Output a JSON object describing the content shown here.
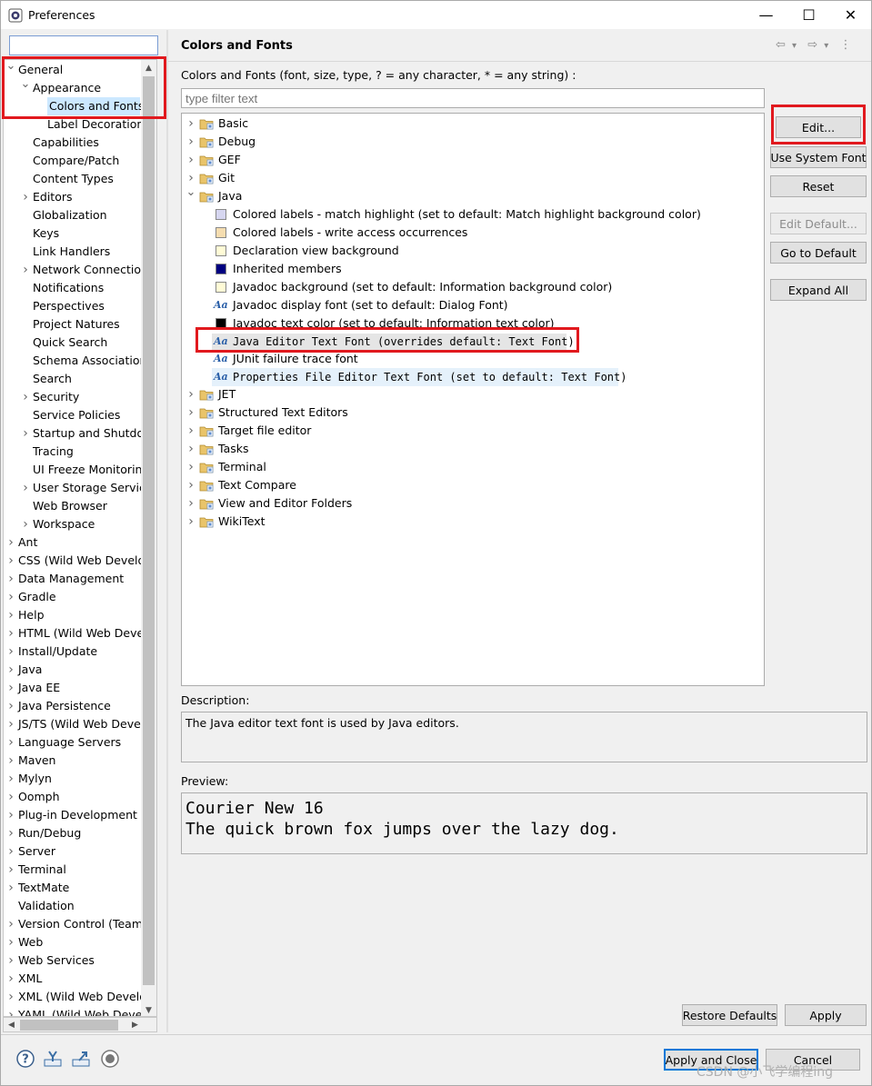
{
  "window": {
    "title": "Preferences",
    "minimize": "—",
    "maximize": "☐",
    "close": "✕"
  },
  "left_tree": {
    "filter_value": "",
    "items": [
      {
        "label": "General",
        "level": 0,
        "state": "expanded"
      },
      {
        "label": "Appearance",
        "level": 1,
        "state": "expanded"
      },
      {
        "label": "Colors and Fonts",
        "level": 2,
        "state": "leaf",
        "selected": true
      },
      {
        "label": "Label Decorations",
        "level": 2,
        "state": "leaf"
      },
      {
        "label": "Capabilities",
        "level": 1,
        "state": "leaf"
      },
      {
        "label": "Compare/Patch",
        "level": 1,
        "state": "leaf"
      },
      {
        "label": "Content Types",
        "level": 1,
        "state": "leaf"
      },
      {
        "label": "Editors",
        "level": 1,
        "state": "collapsed"
      },
      {
        "label": "Globalization",
        "level": 1,
        "state": "leaf"
      },
      {
        "label": "Keys",
        "level": 1,
        "state": "leaf"
      },
      {
        "label": "Link Handlers",
        "level": 1,
        "state": "leaf"
      },
      {
        "label": "Network Connections",
        "level": 1,
        "state": "collapsed"
      },
      {
        "label": "Notifications",
        "level": 1,
        "state": "leaf"
      },
      {
        "label": "Perspectives",
        "level": 1,
        "state": "leaf"
      },
      {
        "label": "Project Natures",
        "level": 1,
        "state": "leaf"
      },
      {
        "label": "Quick Search",
        "level": 1,
        "state": "leaf"
      },
      {
        "label": "Schema Associations",
        "level": 1,
        "state": "leaf"
      },
      {
        "label": "Search",
        "level": 1,
        "state": "leaf"
      },
      {
        "label": "Security",
        "level": 1,
        "state": "collapsed"
      },
      {
        "label": "Service Policies",
        "level": 1,
        "state": "leaf"
      },
      {
        "label": "Startup and Shutdown",
        "level": 1,
        "state": "collapsed"
      },
      {
        "label": "Tracing",
        "level": 1,
        "state": "leaf"
      },
      {
        "label": "UI Freeze Monitoring",
        "level": 1,
        "state": "leaf"
      },
      {
        "label": "User Storage Service",
        "level": 1,
        "state": "collapsed"
      },
      {
        "label": "Web Browser",
        "level": 1,
        "state": "leaf"
      },
      {
        "label": "Workspace",
        "level": 1,
        "state": "collapsed"
      },
      {
        "label": "Ant",
        "level": 0,
        "state": "collapsed"
      },
      {
        "label": "CSS (Wild Web Developer)",
        "level": 0,
        "state": "collapsed"
      },
      {
        "label": "Data Management",
        "level": 0,
        "state": "collapsed"
      },
      {
        "label": "Gradle",
        "level": 0,
        "state": "collapsed"
      },
      {
        "label": "Help",
        "level": 0,
        "state": "collapsed"
      },
      {
        "label": "HTML (Wild Web Developer)",
        "level": 0,
        "state": "collapsed"
      },
      {
        "label": "Install/Update",
        "level": 0,
        "state": "collapsed"
      },
      {
        "label": "Java",
        "level": 0,
        "state": "collapsed"
      },
      {
        "label": "Java EE",
        "level": 0,
        "state": "collapsed"
      },
      {
        "label": "Java Persistence",
        "level": 0,
        "state": "collapsed"
      },
      {
        "label": "JS/TS (Wild Web Developer)",
        "level": 0,
        "state": "collapsed"
      },
      {
        "label": "Language Servers",
        "level": 0,
        "state": "collapsed"
      },
      {
        "label": "Maven",
        "level": 0,
        "state": "collapsed"
      },
      {
        "label": "Mylyn",
        "level": 0,
        "state": "collapsed"
      },
      {
        "label": "Oomph",
        "level": 0,
        "state": "collapsed"
      },
      {
        "label": "Plug-in Development",
        "level": 0,
        "state": "collapsed"
      },
      {
        "label": "Run/Debug",
        "level": 0,
        "state": "collapsed"
      },
      {
        "label": "Server",
        "level": 0,
        "state": "collapsed"
      },
      {
        "label": "Terminal",
        "level": 0,
        "state": "collapsed"
      },
      {
        "label": "TextMate",
        "level": 0,
        "state": "collapsed"
      },
      {
        "label": "Validation",
        "level": 0,
        "state": "leaf"
      },
      {
        "label": "Version Control (Team)",
        "level": 0,
        "state": "collapsed"
      },
      {
        "label": "Web",
        "level": 0,
        "state": "collapsed"
      },
      {
        "label": "Web Services",
        "level": 0,
        "state": "collapsed"
      },
      {
        "label": "XML",
        "level": 0,
        "state": "collapsed"
      },
      {
        "label": "XML (Wild Web Developer)",
        "level": 0,
        "state": "collapsed"
      },
      {
        "label": "YAML (Wild Web Developer)",
        "level": 0,
        "state": "collapsed"
      }
    ]
  },
  "page": {
    "title": "Colors and Fonts",
    "description": "Colors and Fonts (font, size, type, ? = any character, * = any string) :",
    "filter_placeholder": "type filter text",
    "nav": {
      "back": "⇦",
      "back_menu": "▾",
      "forward": "⇨",
      "forward_menu": "▾",
      "more": "⋮"
    }
  },
  "font_tree": [
    {
      "label": "Basic",
      "kind": "category",
      "expanded": false
    },
    {
      "label": "Debug",
      "kind": "category",
      "expanded": false
    },
    {
      "label": "GEF",
      "kind": "category",
      "expanded": false
    },
    {
      "label": "Git",
      "kind": "category",
      "expanded": false
    },
    {
      "label": "Java",
      "kind": "category",
      "expanded": true
    },
    {
      "label": "Colored labels - match highlight (set to default: Match highlight background color)",
      "kind": "color",
      "color": "#d6d6f0"
    },
    {
      "label": "Colored labels - write access occurrences",
      "kind": "color",
      "color": "#f5ddb0"
    },
    {
      "label": "Declaration view background",
      "kind": "color",
      "color": "#fffbd6"
    },
    {
      "label": "Inherited members",
      "kind": "color",
      "color": "#000080"
    },
    {
      "label": "Javadoc background (set to default: Information background color)",
      "kind": "color",
      "color": "#fffbd6"
    },
    {
      "label": "Javadoc display font (set to default: Dialog Font)",
      "kind": "font",
      "mono": false
    },
    {
      "label": "Javadoc text color (set to default: Information text color)",
      "kind": "color",
      "color": "#000000"
    },
    {
      "label": "Java Editor Text Font (overrides default: Text Font)",
      "kind": "font",
      "mono": true,
      "selected": true
    },
    {
      "label": "JUnit failure trace font",
      "kind": "font",
      "mono": false
    },
    {
      "label": "Properties File Editor Text Font (set to default: Text Font)",
      "kind": "font",
      "mono": true,
      "highlight": true
    },
    {
      "label": "JET",
      "kind": "category",
      "expanded": false
    },
    {
      "label": "Structured Text Editors",
      "kind": "category",
      "expanded": false
    },
    {
      "label": "Target file editor",
      "kind": "category",
      "expanded": false
    },
    {
      "label": "Tasks",
      "kind": "category",
      "expanded": false
    },
    {
      "label": "Terminal",
      "kind": "category",
      "expanded": false
    },
    {
      "label": "Text Compare",
      "kind": "category",
      "expanded": false
    },
    {
      "label": "View and Editor Folders",
      "kind": "category",
      "expanded": false
    },
    {
      "label": "WikiText",
      "kind": "category",
      "expanded": false
    }
  ],
  "buttons": {
    "edit": "Edit...",
    "use_system_font": "Use System Font",
    "reset": "Reset",
    "edit_default": "Edit Default...",
    "go_to_default": "Go to Default",
    "expand_all": "Expand All",
    "restore_defaults": "Restore Defaults",
    "apply": "Apply",
    "apply_and_close": "Apply and Close",
    "cancel": "Cancel"
  },
  "description": {
    "label": "Description:",
    "text": "The Java editor text font is used by Java editors."
  },
  "preview": {
    "label": "Preview:",
    "line1": "Courier New 16",
    "line2": "The quick brown fox jumps over the lazy dog."
  },
  "watermark": "CSDN @小飞学编程ing",
  "colors": {
    "highlight_box": "#e1191e",
    "selection": "#cce8ff",
    "aa_icon": "#2a5fa8"
  },
  "icons": [
    "eclipse-app-icon",
    "help-icon",
    "import-icon",
    "export-icon",
    "record-icon",
    "folder-icon",
    "font-icon",
    "color-swatch-icon"
  ]
}
